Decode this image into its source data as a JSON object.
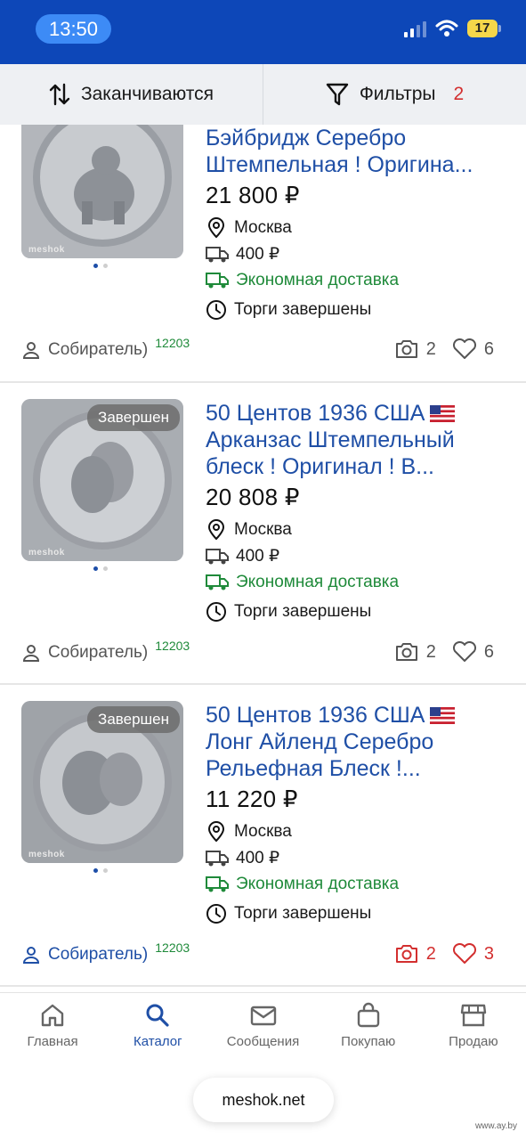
{
  "status": {
    "time": "13:50",
    "battery": "17"
  },
  "toolbar": {
    "sort_label": "Заканчиваются",
    "filter_label": "Фильтры",
    "filter_count": "2"
  },
  "listings": [
    {
      "title_lines": [
        "Бэйбридж Серебро",
        "Штемпельная ! Оригина..."
      ],
      "price": "21 800 ₽",
      "location": "Москва",
      "delivery_price": "400 ₽",
      "delivery_type": "Экономная доставка",
      "auction_status": "Торги завершены",
      "seller": "Собиратель)",
      "seller_rating": "12203",
      "photos": "2",
      "likes": "6",
      "watermark": "meshok"
    },
    {
      "badge": "Завершен",
      "title_lines": [
        "50 Центов 1936 США",
        "Арканзас Штемпельный",
        "блеск ! Оригинал ! В..."
      ],
      "price": "20 808 ₽",
      "location": "Москва",
      "delivery_price": "400 ₽",
      "delivery_type": "Экономная доставка",
      "auction_status": "Торги завершены",
      "seller": "Собиратель)",
      "seller_rating": "12203",
      "photos": "2",
      "likes": "6",
      "watermark": "meshok"
    },
    {
      "badge": "Завершен",
      "title_lines": [
        "50 Центов 1936 США",
        "Лонг Айленд Серебро",
        "Рельефная Блеск !..."
      ],
      "price": "11 220 ₽",
      "location": "Москва",
      "delivery_price": "400 ₽",
      "delivery_type": "Экономная доставка",
      "auction_status": "Торги завершены",
      "seller": "Собиратель)",
      "seller_rating": "12203",
      "photos": "2",
      "likes": "3",
      "watermark": "meshok"
    }
  ],
  "bottom_nav": [
    {
      "label": "Главная",
      "icon": "home-icon"
    },
    {
      "label": "Каталог",
      "icon": "search-icon",
      "active": true
    },
    {
      "label": "Сообщения",
      "icon": "mail-icon"
    },
    {
      "label": "Покупаю",
      "icon": "bag-icon"
    },
    {
      "label": "Продаю",
      "icon": "shop-icon"
    }
  ],
  "browser": {
    "url": "meshok.net"
  },
  "watermark": "www.ay.by",
  "colors": {
    "brand_blue": "#0d47b8",
    "link_blue": "#1f4fa6",
    "green": "#1f8a3a",
    "red": "#d32f2f"
  }
}
